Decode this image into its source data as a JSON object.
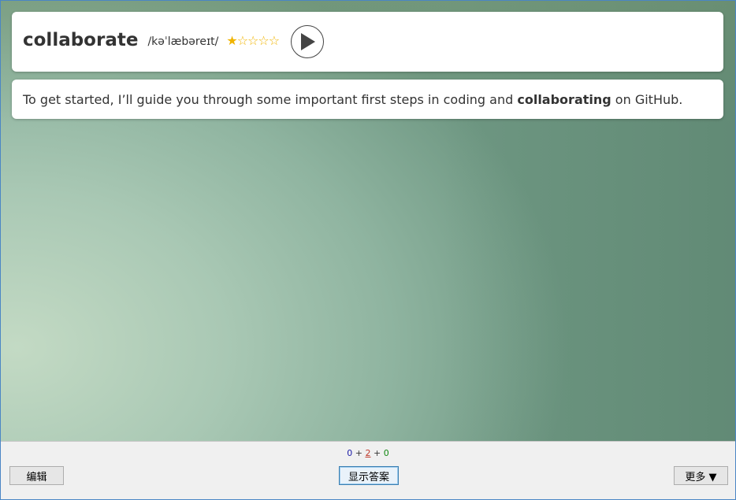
{
  "card": {
    "word": "collaborate",
    "phonetic": "/kəˈlæbəreɪt/",
    "rating": {
      "value": 1,
      "max": 5
    },
    "example": {
      "before": "To get started, I’ll guide you through some important first steps in coding and ",
      "highlight": "collaborating",
      "after": " on GitHub."
    }
  },
  "counts": {
    "new": "0",
    "sep1": " + ",
    "learning": "2",
    "sep2": " + ",
    "review": "0"
  },
  "buttons": {
    "edit": "编辑",
    "show_answer": "显示答案",
    "more": "更多 ▼"
  },
  "icons": {
    "play": "play-icon",
    "star": "star-icon"
  },
  "colors": {
    "star": "#f0b400",
    "count_new": "#1a1aa6",
    "count_learning": "#c0392b",
    "count_review": "#118811",
    "text": "#333333"
  }
}
